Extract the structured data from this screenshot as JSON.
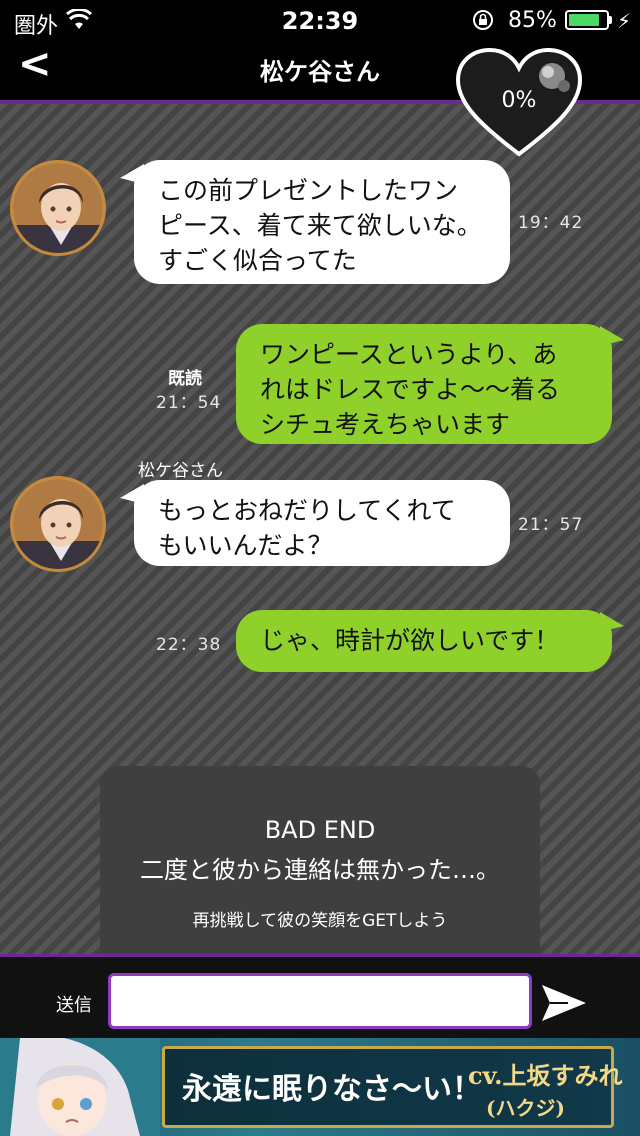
{
  "status_bar": {
    "carrier": "圏外",
    "time": "22:39",
    "battery_percent": "85%",
    "battery_level": 0.85,
    "accent_color": "#4cd964"
  },
  "nav": {
    "back_label": "<",
    "title": "松ケ谷さん"
  },
  "heart_meter": {
    "percent_text": "0%",
    "level": 0
  },
  "messages": [
    {
      "direction": "in",
      "lines": [
        "この前プレゼントしたワン",
        "ピース、着て来て欲しいな。",
        "すごく似合ってた"
      ],
      "time": "19：42"
    },
    {
      "direction": "out",
      "lines": [
        "ワンピースというより、あ",
        "れはドレスですよ〜〜着る",
        "シチュ考えちゃいます"
      ],
      "read_label": "既読",
      "time": "21：54"
    },
    {
      "direction": "in",
      "sender": "松ケ谷さん",
      "lines": [
        "もっとおねだりしてくれて",
        "もいいんだよ？"
      ],
      "time": "21：57"
    },
    {
      "direction": "out",
      "lines": [
        "じゃ、時計が欲しいです！"
      ],
      "time": "22：38"
    }
  ],
  "end_panel": {
    "title": "BAD END",
    "message": "二度と彼から連絡は無かった…。",
    "hint": "再挑戦して彼の笑顔をGETしよう"
  },
  "input_bar": {
    "send_label": "送信",
    "input_value": "",
    "send_icon": "send-arrow-icon"
  },
  "ad": {
    "headline": "永遠に眠りなさ〜い！",
    "cv": "cv.上坂すみれ",
    "cv_sub": "(ハクジ)"
  },
  "colors": {
    "theme_purple": "#6a2b91",
    "outgoing_bubble": "#8fd12a",
    "incoming_bubble": "#ffffff"
  }
}
